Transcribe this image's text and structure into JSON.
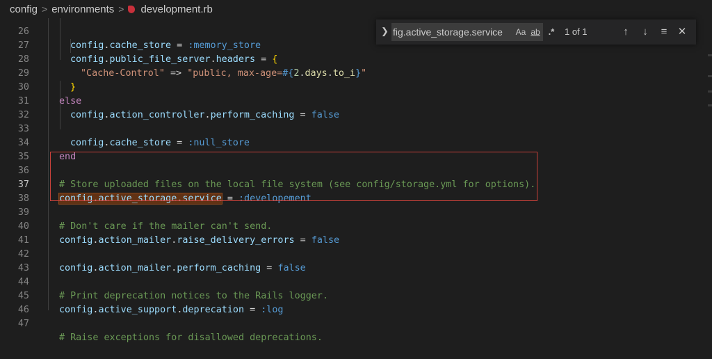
{
  "breadcrumb": {
    "items": [
      "config",
      "environments"
    ],
    "file": "development.rb",
    "file_icon": "ruby-file-icon",
    "separator": ">"
  },
  "find": {
    "query": "fig.active_storage.service",
    "match_case_label": "Aa",
    "whole_word_label": "ab",
    "regex_label": ".*",
    "result_count": "1 of 1",
    "toggle_icon": "chevron-right-icon",
    "prev_icon": "arrow-up-icon",
    "next_icon": "arrow-down-icon",
    "selection_icon": "find-in-selection-icon",
    "close_icon": "close-icon"
  },
  "editor": {
    "language": "ruby",
    "active_line": "37",
    "highlight_box_color": "#c9413a",
    "match_background": "#613214",
    "line_numbers": [
      "27",
      "28",
      "29",
      "30",
      "31",
      "32",
      "33",
      "34",
      "35",
      "36",
      "37",
      "38",
      "39",
      "40",
      "41",
      "42",
      "43",
      "44",
      "45",
      "46",
      "47"
    ],
    "lines": [
      "config.cache_store = :memory_store",
      "config.public_file_server.headers = {",
      "\"Cache-Control\" => \"public, max-age=#{2.days.to_i}\"",
      "}",
      "else",
      "config.action_controller.perform_caching = false",
      "",
      "config.cache_store = :null_store",
      "end",
      "",
      "# Store uploaded files on the local file system (see config/storage.yml for options).",
      "config.active_storage.service = :developement",
      "",
      "# Don't care if the mailer can't send.",
      "config.action_mailer.raise_delivery_errors = false",
      "",
      "config.action_mailer.perform_caching = false",
      "",
      "# Print deprecation notices to the Rails logger.",
      "config.active_support.deprecation = :log",
      "",
      "# Raise exceptions for disallowed deprecations."
    ]
  }
}
